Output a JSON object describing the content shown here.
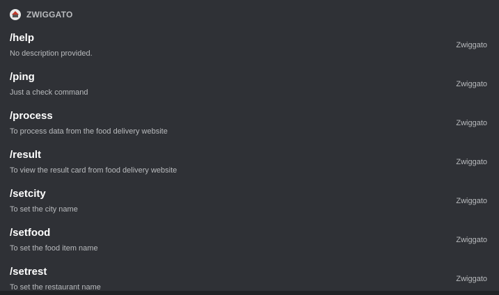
{
  "app": {
    "name": "ZWIGGATO",
    "icon": "zwiggato-app-icon"
  },
  "commands": [
    {
      "name": "/help",
      "description": "No description provided.",
      "source": "Zwiggato"
    },
    {
      "name": "/ping",
      "description": "Just a check command",
      "source": "Zwiggato"
    },
    {
      "name": "/process",
      "description": "To process data from the food delivery website",
      "source": "Zwiggato"
    },
    {
      "name": "/result",
      "description": "To view the result card from food delivery website",
      "source": "Zwiggato"
    },
    {
      "name": "/setcity",
      "description": "To set the city name",
      "source": "Zwiggato"
    },
    {
      "name": "/setfood",
      "description": "To set the food item name",
      "source": "Zwiggato"
    },
    {
      "name": "/setrest",
      "description": "To set the restaurant name",
      "source": "Zwiggato"
    }
  ],
  "colors": {
    "background": "#2f3136",
    "command_text": "#ffffff",
    "muted_text": "#b9bbbe"
  }
}
